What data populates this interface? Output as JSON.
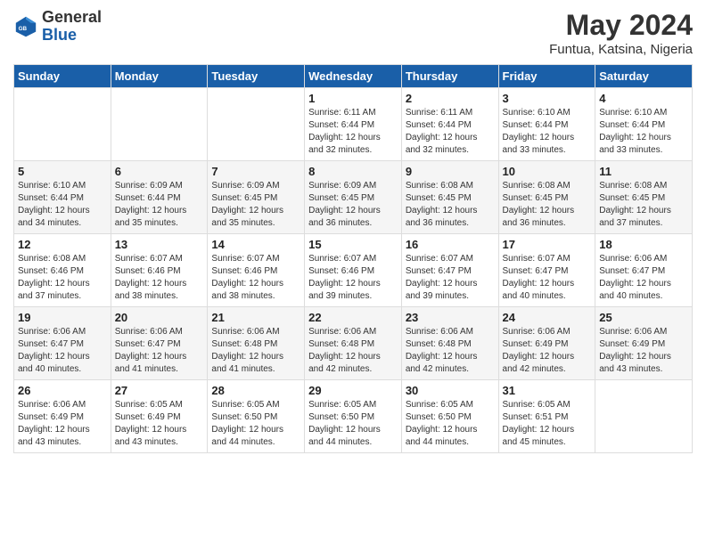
{
  "header": {
    "logo_general": "General",
    "logo_blue": "Blue",
    "title": "May 2024",
    "subtitle": "Funtua, Katsina, Nigeria"
  },
  "days_of_week": [
    "Sunday",
    "Monday",
    "Tuesday",
    "Wednesday",
    "Thursday",
    "Friday",
    "Saturday"
  ],
  "weeks": [
    [
      {
        "day": "",
        "info": ""
      },
      {
        "day": "",
        "info": ""
      },
      {
        "day": "",
        "info": ""
      },
      {
        "day": "1",
        "info": "Sunrise: 6:11 AM\nSunset: 6:44 PM\nDaylight: 12 hours\nand 32 minutes."
      },
      {
        "day": "2",
        "info": "Sunrise: 6:11 AM\nSunset: 6:44 PM\nDaylight: 12 hours\nand 32 minutes."
      },
      {
        "day": "3",
        "info": "Sunrise: 6:10 AM\nSunset: 6:44 PM\nDaylight: 12 hours\nand 33 minutes."
      },
      {
        "day": "4",
        "info": "Sunrise: 6:10 AM\nSunset: 6:44 PM\nDaylight: 12 hours\nand 33 minutes."
      }
    ],
    [
      {
        "day": "5",
        "info": "Sunrise: 6:10 AM\nSunset: 6:44 PM\nDaylight: 12 hours\nand 34 minutes."
      },
      {
        "day": "6",
        "info": "Sunrise: 6:09 AM\nSunset: 6:44 PM\nDaylight: 12 hours\nand 35 minutes."
      },
      {
        "day": "7",
        "info": "Sunrise: 6:09 AM\nSunset: 6:45 PM\nDaylight: 12 hours\nand 35 minutes."
      },
      {
        "day": "8",
        "info": "Sunrise: 6:09 AM\nSunset: 6:45 PM\nDaylight: 12 hours\nand 36 minutes."
      },
      {
        "day": "9",
        "info": "Sunrise: 6:08 AM\nSunset: 6:45 PM\nDaylight: 12 hours\nand 36 minutes."
      },
      {
        "day": "10",
        "info": "Sunrise: 6:08 AM\nSunset: 6:45 PM\nDaylight: 12 hours\nand 36 minutes."
      },
      {
        "day": "11",
        "info": "Sunrise: 6:08 AM\nSunset: 6:45 PM\nDaylight: 12 hours\nand 37 minutes."
      }
    ],
    [
      {
        "day": "12",
        "info": "Sunrise: 6:08 AM\nSunset: 6:46 PM\nDaylight: 12 hours\nand 37 minutes."
      },
      {
        "day": "13",
        "info": "Sunrise: 6:07 AM\nSunset: 6:46 PM\nDaylight: 12 hours\nand 38 minutes."
      },
      {
        "day": "14",
        "info": "Sunrise: 6:07 AM\nSunset: 6:46 PM\nDaylight: 12 hours\nand 38 minutes."
      },
      {
        "day": "15",
        "info": "Sunrise: 6:07 AM\nSunset: 6:46 PM\nDaylight: 12 hours\nand 39 minutes."
      },
      {
        "day": "16",
        "info": "Sunrise: 6:07 AM\nSunset: 6:47 PM\nDaylight: 12 hours\nand 39 minutes."
      },
      {
        "day": "17",
        "info": "Sunrise: 6:07 AM\nSunset: 6:47 PM\nDaylight: 12 hours\nand 40 minutes."
      },
      {
        "day": "18",
        "info": "Sunrise: 6:06 AM\nSunset: 6:47 PM\nDaylight: 12 hours\nand 40 minutes."
      }
    ],
    [
      {
        "day": "19",
        "info": "Sunrise: 6:06 AM\nSunset: 6:47 PM\nDaylight: 12 hours\nand 40 minutes."
      },
      {
        "day": "20",
        "info": "Sunrise: 6:06 AM\nSunset: 6:47 PM\nDaylight: 12 hours\nand 41 minutes."
      },
      {
        "day": "21",
        "info": "Sunrise: 6:06 AM\nSunset: 6:48 PM\nDaylight: 12 hours\nand 41 minutes."
      },
      {
        "day": "22",
        "info": "Sunrise: 6:06 AM\nSunset: 6:48 PM\nDaylight: 12 hours\nand 42 minutes."
      },
      {
        "day": "23",
        "info": "Sunrise: 6:06 AM\nSunset: 6:48 PM\nDaylight: 12 hours\nand 42 minutes."
      },
      {
        "day": "24",
        "info": "Sunrise: 6:06 AM\nSunset: 6:49 PM\nDaylight: 12 hours\nand 42 minutes."
      },
      {
        "day": "25",
        "info": "Sunrise: 6:06 AM\nSunset: 6:49 PM\nDaylight: 12 hours\nand 43 minutes."
      }
    ],
    [
      {
        "day": "26",
        "info": "Sunrise: 6:06 AM\nSunset: 6:49 PM\nDaylight: 12 hours\nand 43 minutes."
      },
      {
        "day": "27",
        "info": "Sunrise: 6:05 AM\nSunset: 6:49 PM\nDaylight: 12 hours\nand 43 minutes."
      },
      {
        "day": "28",
        "info": "Sunrise: 6:05 AM\nSunset: 6:50 PM\nDaylight: 12 hours\nand 44 minutes."
      },
      {
        "day": "29",
        "info": "Sunrise: 6:05 AM\nSunset: 6:50 PM\nDaylight: 12 hours\nand 44 minutes."
      },
      {
        "day": "30",
        "info": "Sunrise: 6:05 AM\nSunset: 6:50 PM\nDaylight: 12 hours\nand 44 minutes."
      },
      {
        "day": "31",
        "info": "Sunrise: 6:05 AM\nSunset: 6:51 PM\nDaylight: 12 hours\nand 45 minutes."
      },
      {
        "day": "",
        "info": ""
      }
    ]
  ]
}
